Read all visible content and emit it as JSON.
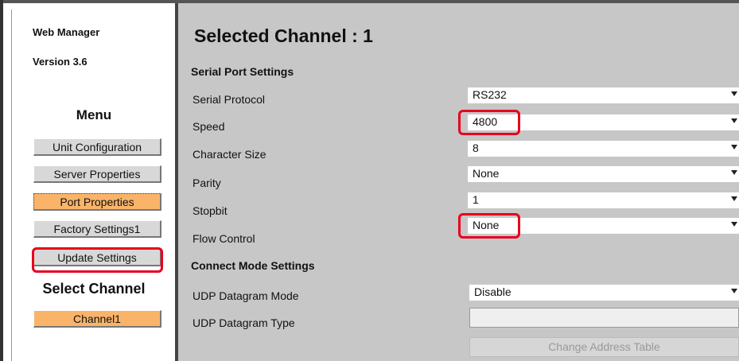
{
  "sidebar": {
    "app_name": "Web Manager",
    "version": "Version 3.6",
    "menu_heading": "Menu",
    "buttons": {
      "unit_configuration": "Unit Configuration",
      "server_properties": "Server Properties",
      "port_properties": "Port Properties",
      "factory_settings": "Factory Settings1",
      "update_settings": "Update Settings"
    },
    "select_channel_heading": "Select Channel",
    "channel_button": "Channel1"
  },
  "main": {
    "title": "Selected Channel : 1",
    "serial_section": "Serial Port Settings",
    "fields": {
      "serial_protocol": {
        "label": "Serial Protocol",
        "value": "RS232"
      },
      "speed": {
        "label": "Speed",
        "value": "4800"
      },
      "character_size": {
        "label": "Character Size",
        "value": "8"
      },
      "parity": {
        "label": "Parity",
        "value": "None"
      },
      "stopbit": {
        "label": "Stopbit",
        "value": "1"
      },
      "flow_control": {
        "label": "Flow Control",
        "value": "None"
      }
    },
    "connect_section": "Connect Mode Settings",
    "udp_mode": {
      "label": "UDP Datagram Mode",
      "value": "Disable"
    },
    "udp_type": {
      "label": "UDP Datagram Type",
      "value": ""
    },
    "change_address_button": "Change Address Table"
  },
  "colors": {
    "highlight": "#e8001c",
    "active_button": "#f9b46a",
    "panel_bg": "#c7c7c7"
  }
}
